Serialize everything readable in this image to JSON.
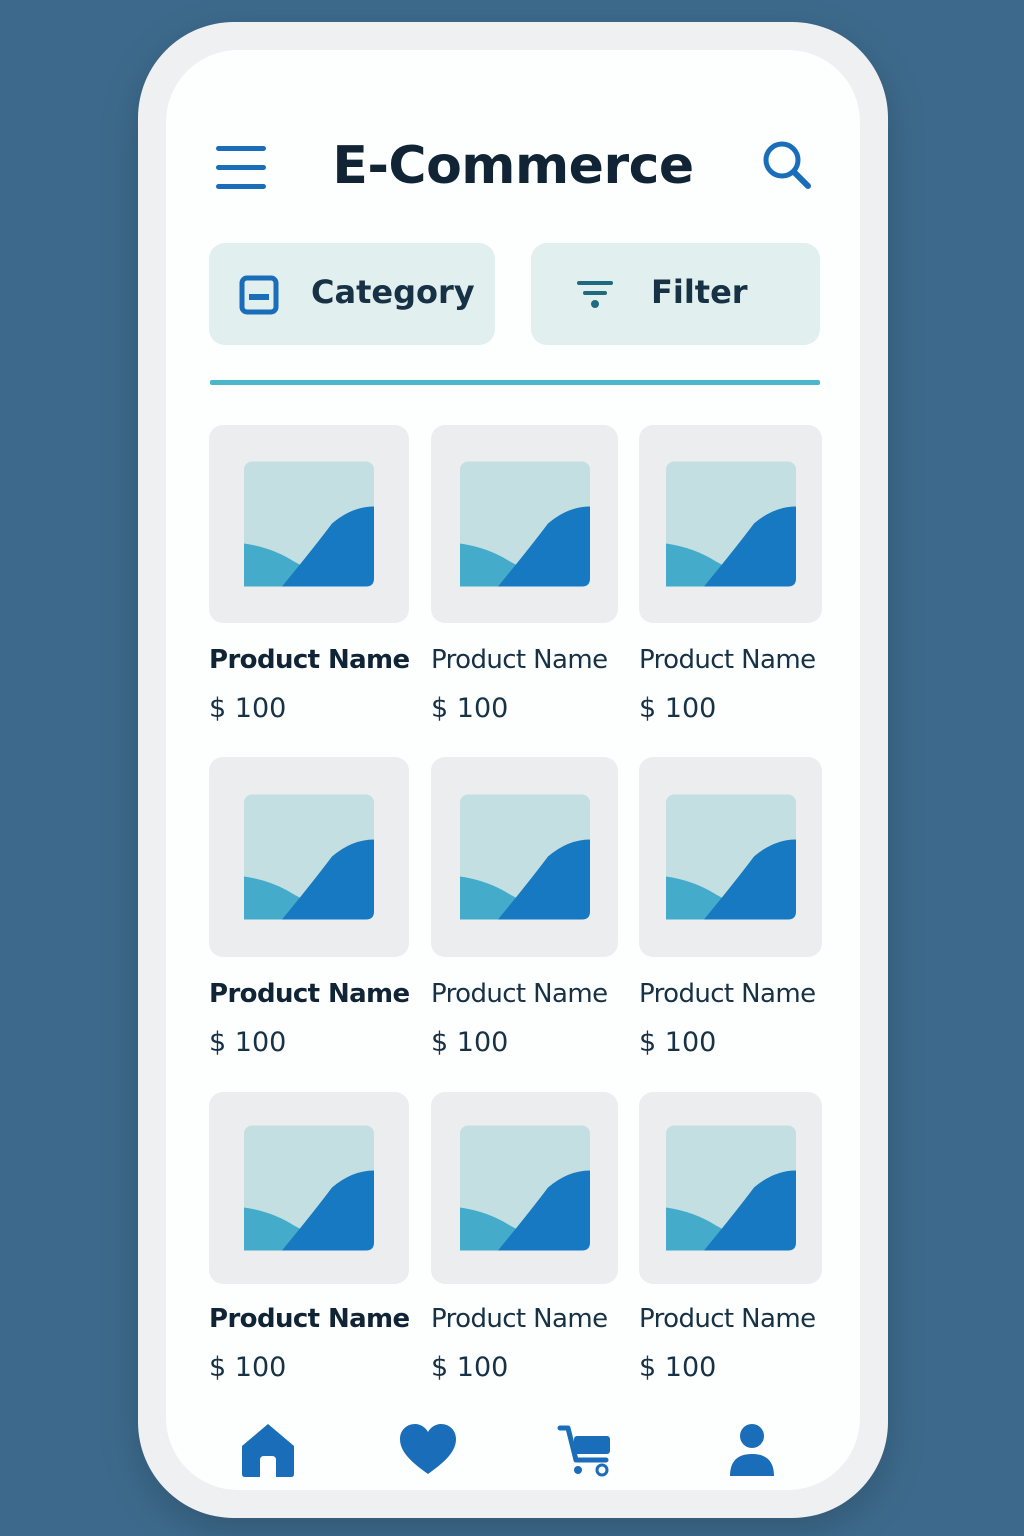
{
  "header": {
    "title": "E-Commerce",
    "menu_icon": "hamburger-menu-icon",
    "search_icon": "search-icon"
  },
  "toolbar": {
    "category_label": "Category",
    "category_icon": "category-icon",
    "filter_label": "Filter",
    "filter_icon": "filter-icon"
  },
  "products": [
    {
      "name": "Product Name",
      "price": "$ 100"
    },
    {
      "name": "Product Name",
      "price": "$ 100"
    },
    {
      "name": "Product Name",
      "price": "$ 100"
    },
    {
      "name": "Product Name",
      "price": "$ 100"
    },
    {
      "name": "Product Name",
      "price": "$ 100"
    },
    {
      "name": "Product Name",
      "price": "$ 100"
    },
    {
      "name": "Product Name",
      "price": "$ 100"
    },
    {
      "name": "Product Name",
      "price": "$ 100"
    },
    {
      "name": "Product Name",
      "price": "$ 100"
    }
  ],
  "bottom_nav": [
    {
      "icon": "home-icon"
    },
    {
      "icon": "heart-icon"
    },
    {
      "icon": "cart-icon"
    },
    {
      "icon": "user-icon"
    }
  ],
  "colors": {
    "background": "#3d6a8c",
    "accent": "#1a6db9",
    "chip_bg": "#e1efef",
    "divider": "#4cb5c9",
    "text_dark": "#102436"
  }
}
